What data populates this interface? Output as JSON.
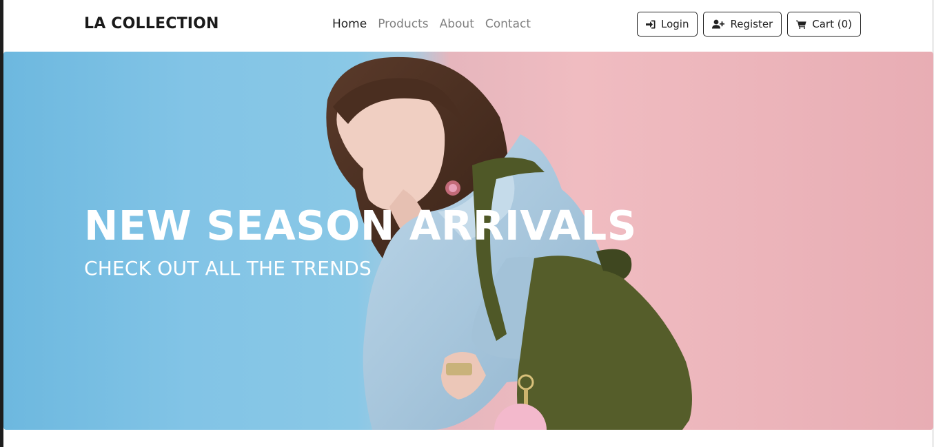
{
  "brand": {
    "name": "LA COLLECTION"
  },
  "nav": {
    "links": [
      {
        "label": "Home",
        "active": true
      },
      {
        "label": "Products",
        "active": false
      },
      {
        "label": "About",
        "active": false
      },
      {
        "label": "Contact",
        "active": false
      }
    ],
    "buttons": {
      "login": {
        "label": "Login",
        "icon": "sign-in-icon"
      },
      "register": {
        "label": "Register",
        "icon": "user-plus-icon"
      },
      "cart": {
        "label": "Cart (0)",
        "icon": "shopping-cart-icon"
      }
    }
  },
  "hero": {
    "title": "NEW SEASON ARRIVALS",
    "subtitle": "CHECK OUT ALL THE TRENDS"
  },
  "colors": {
    "text_dark": "#212121",
    "nav_muted": "#808080",
    "hero_blue": "#82c4e6",
    "hero_pink": "#f0bcc1",
    "jacket": "#a9c8de",
    "backpack": "#555d2a"
  }
}
